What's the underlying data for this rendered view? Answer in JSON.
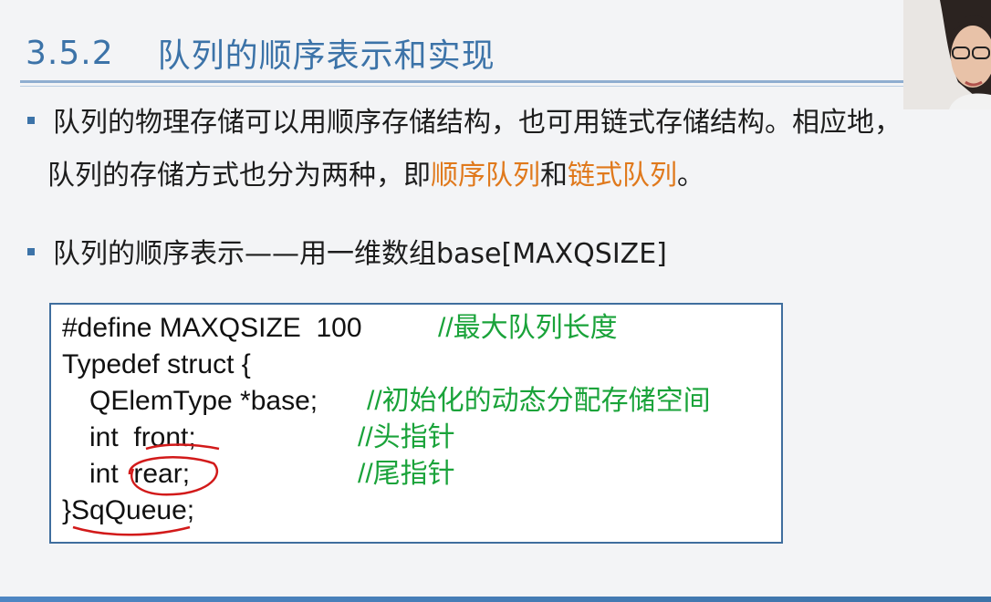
{
  "slide": {
    "section_number": "3.5.2",
    "title": "队列的顺序表示和实现",
    "bullet1_line1": "队列的物理存储可以用顺序存储结构，也可用链式存储结构。相应地，",
    "bullet1_line2_a": "队列的存储方式也分为两种，即",
    "bullet1_line2_b": "顺序队列",
    "bullet1_line2_c": "和",
    "bullet1_line2_d": "链式队列",
    "bullet1_line2_e": "。",
    "bullet2": "队列的顺序表示——用一维数组base[MAXQSIZE]"
  },
  "code": {
    "line1": "#define MAXQSIZE  100",
    "line1_comment": "//最大队列长度",
    "line2": "Typedef struct {",
    "line3": "QElemType *base;",
    "line3_comment": "//初始化的动态分配存储空间",
    "line4": "int  front;",
    "line4_comment": "//头指针",
    "line5": "int  rear;",
    "line5_comment": "//尾指针",
    "line6": "}SqQueue;"
  },
  "colors": {
    "title": "#3c73a8",
    "highlight": "#e0791c",
    "comment": "#1aa33a",
    "annotation": "#d21a1a"
  }
}
